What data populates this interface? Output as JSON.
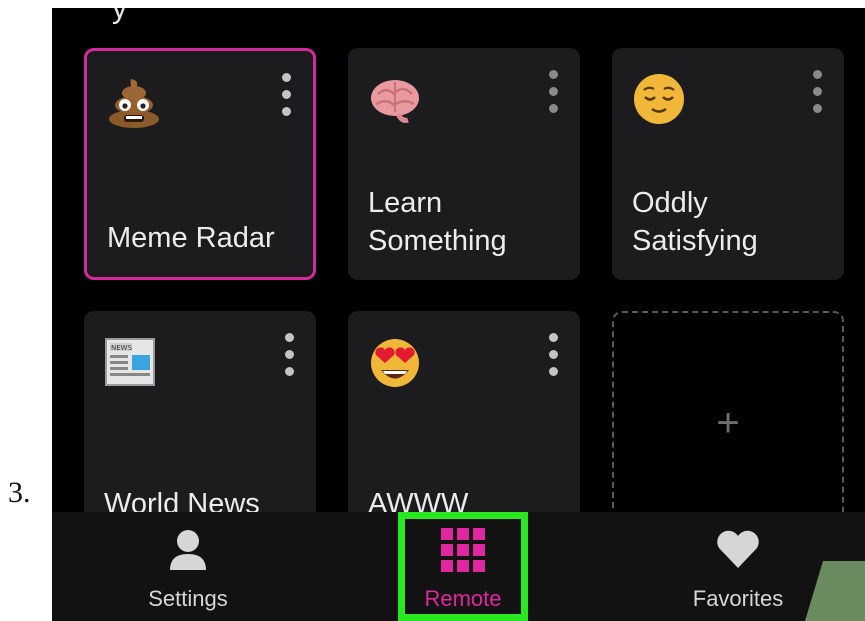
{
  "step_number": "3.",
  "header_partial": "y",
  "cards": [
    {
      "label": "Meme Radar",
      "icon": "poop-emoji-icon",
      "selected": true
    },
    {
      "label": "Learn Something",
      "icon": "brain-emoji-icon",
      "selected": false
    },
    {
      "label": "Oddly Satisfying",
      "icon": "relieved-face-emoji-icon",
      "selected": false
    },
    {
      "label": "World News",
      "icon": "newspaper-emoji-icon",
      "selected": false
    },
    {
      "label": "AWWW",
      "icon": "heart-eyes-emoji-icon",
      "selected": false
    }
  ],
  "add_card": {
    "symbol": "+"
  },
  "tabbar": {
    "settings_label": "Settings",
    "remote_label": "Remote",
    "favorites_label": "Favorites",
    "active_tab": "Remote"
  },
  "colors": {
    "accent": "#e0279f",
    "highlight": "#29e822",
    "card_bg": "#1c1c1e",
    "screen_bg": "#000000"
  }
}
